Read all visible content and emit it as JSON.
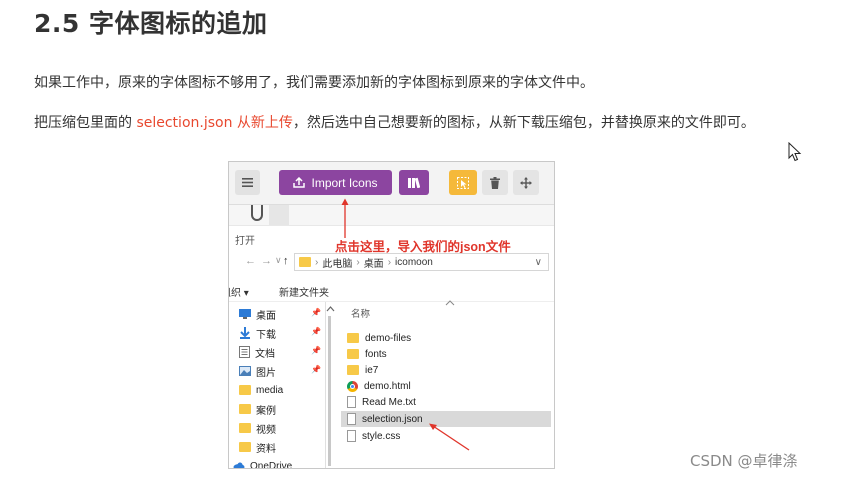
{
  "heading": "2.5 字体图标的追加",
  "paragraphs": {
    "p1": "如果工作中，原来的字体图标不够用了，我们需要添加新的字体图标到原来的字体文件中。",
    "p2_before": "把压缩包里面的 ",
    "p2_highlight": "selection.json 从新上传",
    "p2_after": "，然后选中自己想要新的图标，从新下载压缩包，并替换原来的文件即可。"
  },
  "screenshot": {
    "toolbar": {
      "import_label": "Import Icons"
    },
    "open_label": "打开",
    "annotation": "点击这里，导入我们的json文件",
    "breadcrumb": [
      "此电脑",
      "桌面",
      "icomoon"
    ],
    "commands": {
      "organize": "组织 ▾",
      "new_folder": "新建文件夹"
    },
    "nav_items": [
      {
        "label": "桌面",
        "icon": "desktop-icon",
        "pinned": true
      },
      {
        "label": "下载",
        "icon": "download-icon",
        "pinned": true
      },
      {
        "label": "文档",
        "icon": "document-icon",
        "pinned": true
      },
      {
        "label": "图片",
        "icon": "picture-icon",
        "pinned": true
      },
      {
        "label": "media",
        "icon": "folder-icon",
        "pinned": false
      },
      {
        "label": "案例",
        "icon": "folder-icon",
        "pinned": false
      },
      {
        "label": "视频",
        "icon": "folder-icon",
        "pinned": false
      },
      {
        "label": "资料",
        "icon": "folder-icon",
        "pinned": false
      },
      {
        "label": "OneDrive",
        "icon": "cloud-icon",
        "pinned": false
      }
    ],
    "column_header": "名称",
    "files": [
      {
        "name": "demo-files",
        "icon": "folder-icon",
        "selected": false
      },
      {
        "name": "fonts",
        "icon": "folder-icon",
        "selected": false
      },
      {
        "name": "ie7",
        "icon": "folder-icon",
        "selected": false
      },
      {
        "name": "demo.html",
        "icon": "chrome-icon",
        "selected": false
      },
      {
        "name": "Read Me.txt",
        "icon": "text-file-icon",
        "selected": false
      },
      {
        "name": "selection.json",
        "icon": "json-file-icon",
        "selected": true
      },
      {
        "name": "style.css",
        "icon": "css-file-icon",
        "selected": false
      }
    ]
  },
  "colors": {
    "accent_red": "#e8482f",
    "import_purple": "#8c45a0",
    "select_yellow": "#f5b93a"
  },
  "watermark": "CSDN @卓律涤"
}
